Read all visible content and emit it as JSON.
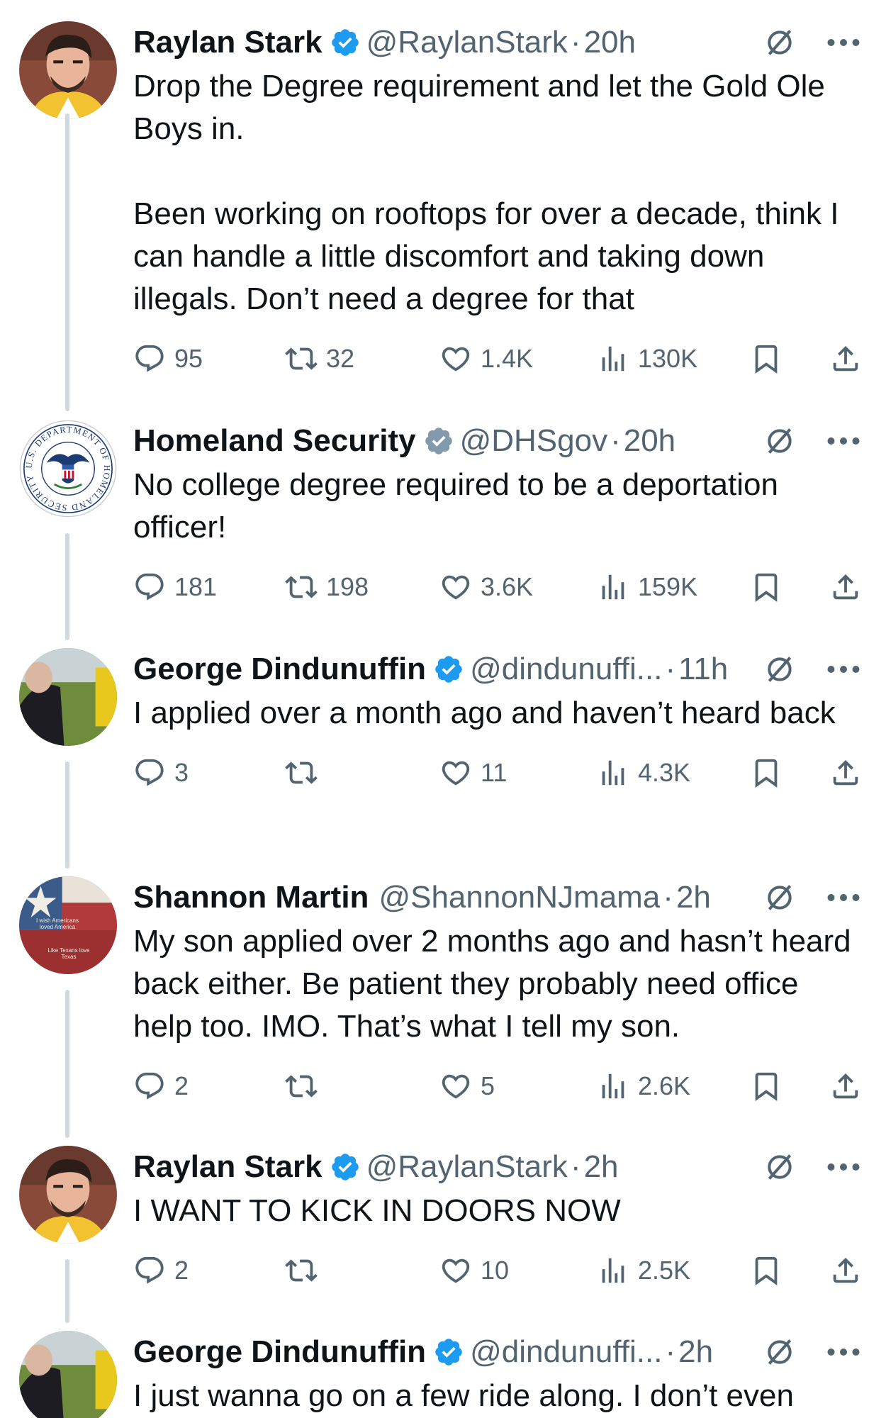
{
  "tweets": [
    {
      "name": "Raylan Stark",
      "verified": "blue",
      "handle": "@RaylanStark",
      "time": "20h",
      "text": "Drop the Degree requirement and let the Gold Ole Boys in.\n\nBeen working on rooftops for over a decade, think I can handle a little discomfort and taking down illegals. Don’t need a degree for that",
      "replies": "95",
      "retweets": "32",
      "likes": "1.4K",
      "views": "130K"
    },
    {
      "name": "Homeland Security",
      "verified": "grey",
      "handle": "@DHSgov",
      "time": "20h",
      "text": "No college degree required to be a deportation officer!",
      "replies": "181",
      "retweets": "198",
      "likes": "3.6K",
      "views": "159K"
    },
    {
      "name": "George Dindunuffin",
      "verified": "blue",
      "handle": "@dindunuffi...",
      "time": "11h",
      "text": "I applied over a month ago and haven’t heard back",
      "replies": "3",
      "retweets": "",
      "likes": "11",
      "views": "4.3K"
    },
    {
      "name": "Shannon Martin",
      "verified": "none",
      "handle": "@ShannonNJmama",
      "time": "2h",
      "text": "My son applied over 2 months ago and hasn’t heard back either. Be patient they probably need office help too. IMO. That’s what I tell my son.",
      "replies": "2",
      "retweets": "",
      "likes": "5",
      "views": "2.6K"
    },
    {
      "name": "Raylan Stark",
      "verified": "blue",
      "handle": "@RaylanStark",
      "time": "2h",
      "text": "I WANT TO KICK IN DOORS NOW",
      "replies": "2",
      "retweets": "",
      "likes": "10",
      "views": "2.5K"
    },
    {
      "name": "George Dindunuffin",
      "verified": "blue",
      "handle": "@dindunuffi...",
      "time": "2h",
      "text": "I just wanna go on a few ride along. I don’t even",
      "replies": "",
      "retweets": "",
      "likes": "",
      "views": ""
    }
  ],
  "dhs_seal_text": "U.S. DEPARTMENT OF HOMELAND SECURITY",
  "shannon_avatar_text": [
    "I wish Americans loved America",
    "Like Texans love Texas"
  ],
  "separator": "·",
  "colors": {
    "text": "#0f1419",
    "muted": "#536471",
    "verified_blue": "#1d9bf0",
    "verified_grey": "#829aab",
    "thread_line": "#cfd9de"
  }
}
